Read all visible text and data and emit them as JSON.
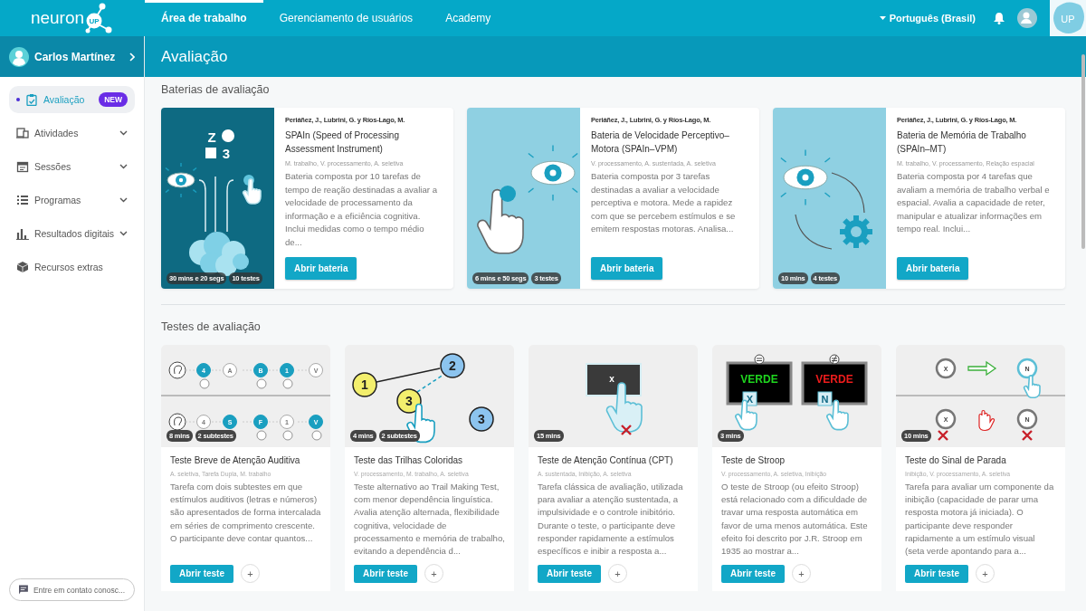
{
  "header": {
    "logo": "neuron",
    "logo_badge": "UP",
    "nav": [
      {
        "label": "Área de trabalho",
        "selected": true
      },
      {
        "label": "Gerenciamento de usuários",
        "selected": false
      },
      {
        "label": "Academy",
        "selected": false
      }
    ],
    "language": "Português (Brasil)",
    "corner_logo": "UP"
  },
  "user": {
    "name": "Carlos Martínez"
  },
  "page_title": "Avaliação",
  "sidebar": {
    "items": [
      {
        "label": "Avaliação",
        "kind": "clipboard",
        "selected": true,
        "badge": "NEW",
        "has_submenu": false
      },
      {
        "label": "Atividades",
        "kind": "devices",
        "selected": false,
        "has_submenu": true
      },
      {
        "label": "Sessões",
        "kind": "calendar",
        "selected": false,
        "has_submenu": true
      },
      {
        "label": "Programas",
        "kind": "list",
        "selected": false,
        "has_submenu": true
      },
      {
        "label": "Resultados digitais",
        "kind": "bars",
        "selected": false,
        "has_submenu": true
      },
      {
        "label": "Recursos extras",
        "kind": "box",
        "selected": false,
        "has_submenu": false
      }
    ],
    "contact": "Entre em contato conosc..."
  },
  "batteries_title": "Baterias de avaliação",
  "batteries": [
    {
      "authors": "Periáñez, J., Lubrini, G. y Ríos-Lago, M.",
      "title": "SPAIn (Speed of Processing Assessment Instrument)",
      "tags": "M. trabalho, V. processamento, A. seletiva",
      "description": "Bateria composta por 10 tarefas de tempo de reação destinadas a avaliar a velocidade de processamento da informação e a eficiência cognitiva. Inclui medidas como o tempo médio de...",
      "duration": "30 mins e 20 segs",
      "count": "10 testes",
      "button": "Abrir bateria",
      "illustration": {
        "kind": "speed",
        "labels": [
          "Z",
          "3"
        ]
      }
    },
    {
      "authors": "Periáñez, J., Lubrini, G. y Ríos-Lago, M.",
      "title": "Bateria de Velocidade Perceptivo–Motora (SPAIn–VPM)",
      "tags": "V. processamento, A. sustentada, A. seletiva",
      "description": "Bateria composta por 3 tarefas destinadas a avaliar a velocidade perceptiva e motora. Mede a rapidez com que se percebem estímulos e se emitem respostas motoras. Analisa...",
      "duration": "6 mins e 50 segs",
      "count": "3 testes",
      "button": "Abrir bateria",
      "illustration": {
        "kind": "motor"
      }
    },
    {
      "authors": "Periáñez, J., Lubrini, G. y Ríos-Lago, M.",
      "title": "Bateria de Memória de Trabalho (SPAIn–MT)",
      "tags": "M. trabalho, V. processamento, Relação espacial",
      "description": "Bateria composta por 4 tarefas que avaliam a memória de trabalho verbal e espacial. Avalia a capacidade de reter, manipular e atualizar informações em tempo real. Inclui...",
      "duration": "10 mins",
      "count": "4 testes",
      "button": "Abrir bateria",
      "illustration": {
        "kind": "memory"
      }
    }
  ],
  "tests_title": "Testes de avaliação",
  "tests": [
    {
      "title": "Teste Breve de Atenção Auditiva",
      "tags": "A. seletiva, Tarefa Dupla, M. trabalho",
      "description": "Tarefa com dois subtestes em que estímulos auditivos (letras e números) são apresentados de forma intercalada em séries de comprimento crescente. O participante deve contar quantos...",
      "duration": "8 mins",
      "count": "2 subtestes",
      "button": "Abrir teste",
      "add": "+",
      "illustration": {
        "kind": "auditory",
        "labels": [
          "4",
          "A",
          "B",
          "1",
          "V",
          "4",
          "S",
          "F",
          "1",
          "V"
        ]
      }
    },
    {
      "title": "Teste das Trilhas Coloridas",
      "tags": "V. processamento, M. trabalho, A. seletiva",
      "description": "Teste alternativo ao Trail Making Test, com menor dependência linguística. Avalia atenção alternada, flexibilidade cognitiva, velocidade de processamento e memória de trabalho, evitando a dependência d...",
      "duration": "4 mins",
      "count": "2 subtestes",
      "button": "Abrir teste",
      "add": "+",
      "illustration": {
        "kind": "trails",
        "labels": [
          "1",
          "2",
          "3",
          "3"
        ]
      }
    },
    {
      "title": "Teste de Atenção Contínua (CPT)",
      "tags": "A. sustentada, Inibição, A. seletiva",
      "description": "Tarefa clássica de avaliação, utilizada para avaliar a atenção sustentada, a impulsividade e o controle inibitório. Durante o teste, o participante deve responder rapidamente a estímulos específicos e inibir a resposta a...",
      "duration": "15 mins",
      "button": "Abrir teste",
      "add": "+",
      "illustration": {
        "kind": "cpt",
        "labels": [
          "x"
        ]
      }
    },
    {
      "title": "Teste de Stroop",
      "tags": "V. processamento, A. seletiva, Inibição",
      "description": "O teste de Stroop (ou efeito Stroop) está relacionado com a dificuldade de travar uma resposta automática em favor de uma menos automática. Este efeito foi descrito por J.R. Stroop em 1935 ao mostrar a...",
      "duration": "3 mins",
      "button": "Abrir teste",
      "add": "+",
      "illustration": {
        "kind": "stroop",
        "labels": [
          "VERDE",
          "VERDE",
          "X",
          "N"
        ]
      }
    },
    {
      "title": "Teste do Sinal de Parada",
      "tags": "Inibição, V. processamento, A. seletiva",
      "description": "Tarefa para avaliar um componente da inibição (capacidade de parar uma resposta motora já iniciada). O participante deve responder rapidamente a um estímulo visual (seta verde apontando para a...",
      "duration": "10 mins",
      "button": "Abrir teste",
      "add": "+",
      "illustration": {
        "kind": "stop",
        "labels": [
          "X",
          "N",
          "X",
          "N"
        ]
      }
    }
  ]
}
